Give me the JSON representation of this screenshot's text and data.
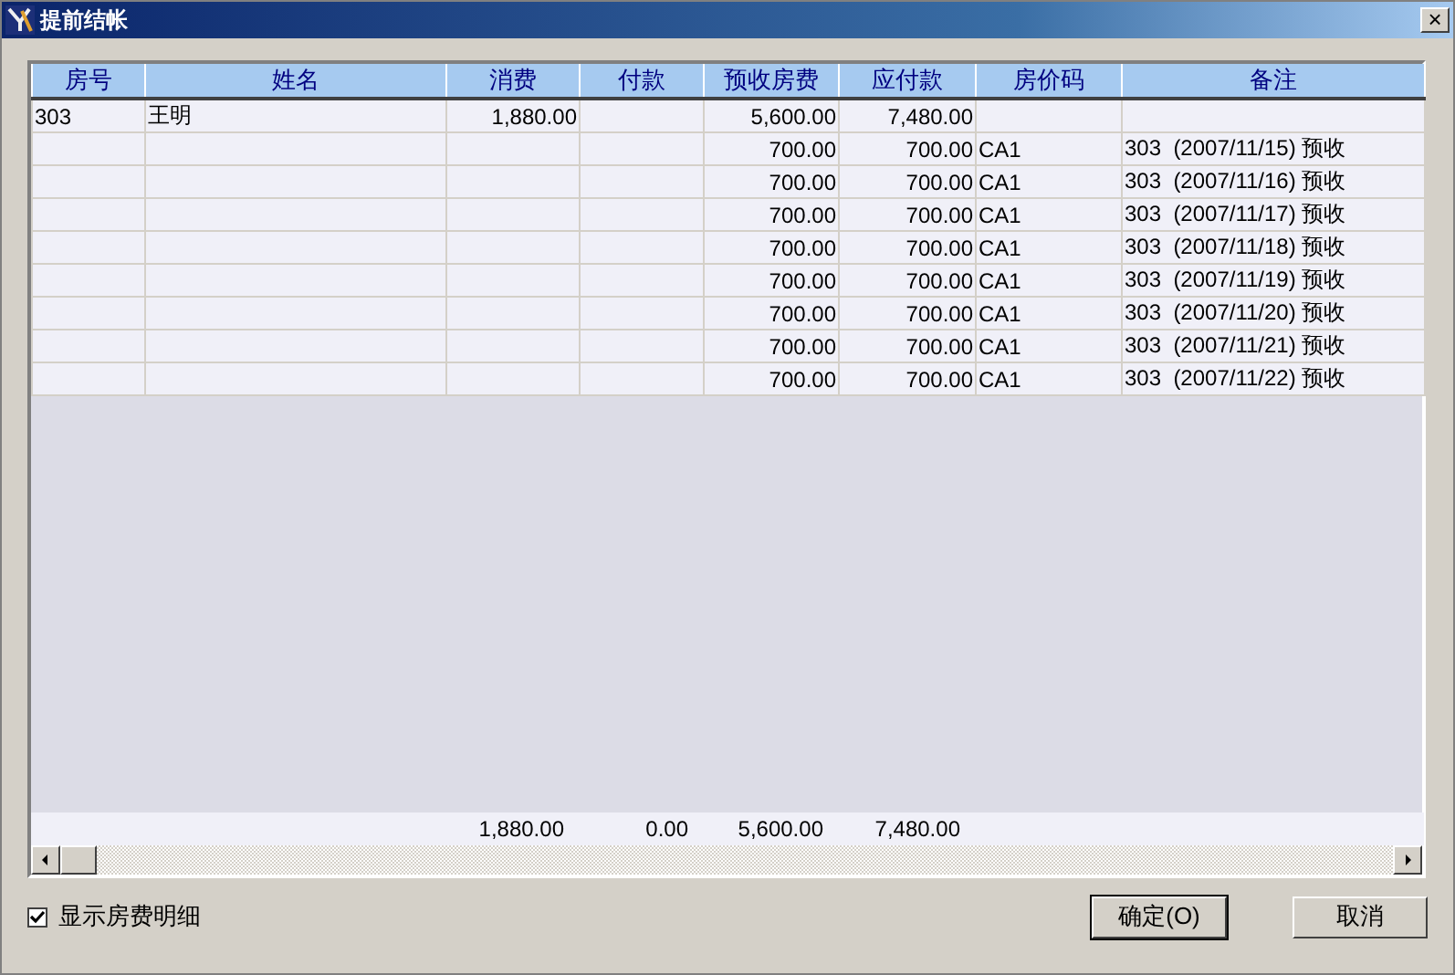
{
  "window": {
    "title": "提前结帐",
    "close": "×"
  },
  "table": {
    "columns": [
      {
        "label": "房号"
      },
      {
        "label": "姓名"
      },
      {
        "label": "消费"
      },
      {
        "label": "付款"
      },
      {
        "label": "预收房费"
      },
      {
        "label": "应付款"
      },
      {
        "label": "房价码"
      },
      {
        "label": "备注"
      }
    ],
    "rows": [
      {
        "room": "303",
        "name": "王明",
        "consumption": "1,880.00",
        "prepaid": "5,600.00",
        "payable": "7,480.00"
      },
      {
        "prepaid": "700.00",
        "payable": "700.00",
        "rate_code": "CA1",
        "remark": "303  (2007/11/15) 预收"
      },
      {
        "prepaid": "700.00",
        "payable": "700.00",
        "rate_code": "CA1",
        "remark": "303  (2007/11/16) 预收"
      },
      {
        "prepaid": "700.00",
        "payable": "700.00",
        "rate_code": "CA1",
        "remark": "303  (2007/11/17) 预收"
      },
      {
        "prepaid": "700.00",
        "payable": "700.00",
        "rate_code": "CA1",
        "remark": "303  (2007/11/18) 预收"
      },
      {
        "prepaid": "700.00",
        "payable": "700.00",
        "rate_code": "CA1",
        "remark": "303  (2007/11/19) 预收"
      },
      {
        "prepaid": "700.00",
        "payable": "700.00",
        "rate_code": "CA1",
        "remark": "303  (2007/11/20) 预收"
      },
      {
        "prepaid": "700.00",
        "payable": "700.00",
        "rate_code": "CA1",
        "remark": "303  (2007/11/21) 预收"
      },
      {
        "prepaid": "700.00",
        "payable": "700.00",
        "rate_code": "CA1",
        "remark": "303  (2007/11/22) 预收"
      }
    ],
    "totals": {
      "consumption": "1,880.00",
      "payment": "0.00",
      "prepaid": "5,600.00",
      "payable": "7,480.00"
    }
  },
  "show_details": {
    "label": "显示房费明细",
    "checked": true
  },
  "buttons": [
    {
      "label": "确定(O)",
      "default": true
    },
    {
      "label": "取消",
      "default": false
    }
  ]
}
